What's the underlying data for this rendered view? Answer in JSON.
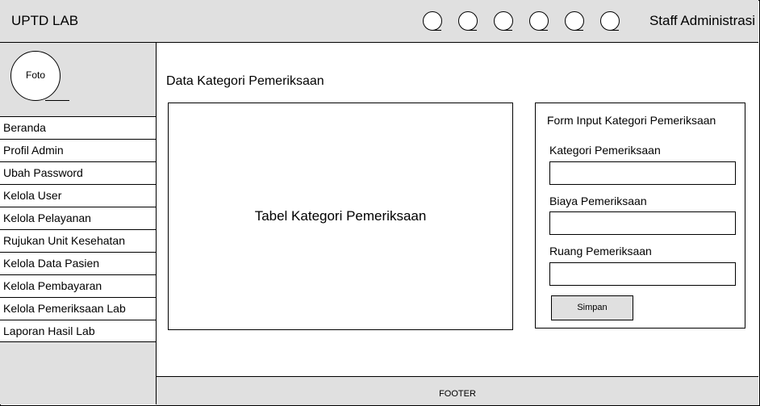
{
  "header": {
    "title": "UPTD LAB",
    "user": "Staff Administrasi",
    "icons": [
      "circle-icon",
      "circle-icon",
      "circle-icon",
      "circle-icon",
      "circle-icon",
      "circle-icon"
    ]
  },
  "sidebar": {
    "avatar_label": "Foto",
    "items": [
      {
        "label": "Beranda"
      },
      {
        "label": "Profil Admin"
      },
      {
        "label": "Ubah Password"
      },
      {
        "label": "Kelola User"
      },
      {
        "label": "Kelola Pelayanan"
      },
      {
        "label": "Rujukan Unit Kesehatan"
      },
      {
        "label": "Kelola Data Pasien"
      },
      {
        "label": "Kelola Pembayaran"
      },
      {
        "label": "Kelola Pemeriksaan Lab"
      },
      {
        "label": "Laporan Hasil Lab"
      }
    ]
  },
  "main": {
    "title": "Data Kategori Pemeriksaan",
    "table_placeholder": "Tabel Kategori Pemeriksaan"
  },
  "form": {
    "title": "Form Input Kategori Pemeriksaan",
    "fields": [
      {
        "label": "Kategori Pemeriksaan",
        "value": ""
      },
      {
        "label": "Biaya Pemeriksaan",
        "value": ""
      },
      {
        "label": "Ruang Pemeriksaan",
        "value": ""
      }
    ],
    "submit": "Simpan"
  },
  "footer": {
    "text": "FOOTER"
  }
}
